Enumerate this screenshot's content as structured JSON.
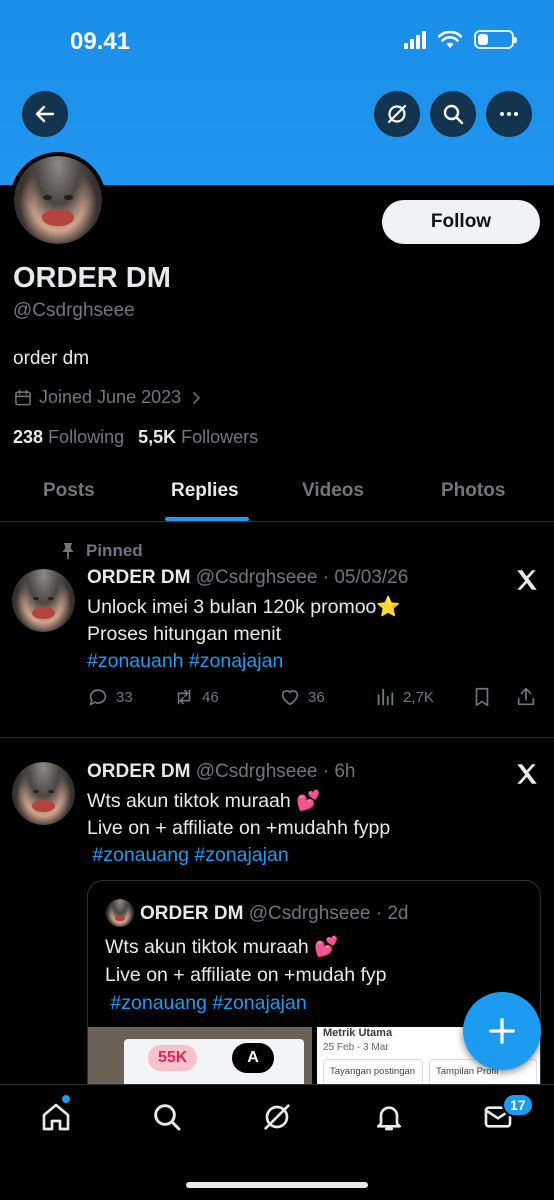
{
  "status_bar": {
    "time": "09.41"
  },
  "profile": {
    "display_name": "ORDER DM",
    "handle": "@Csdrghseee",
    "bio": "order dm",
    "joined": "Joined June 2023",
    "following_count": "238",
    "following_label": "Following",
    "followers_count": "5,5K",
    "followers_label": "Followers",
    "follow_button": "Follow"
  },
  "tabs": [
    "Posts",
    "Replies",
    "Videos",
    "Photos"
  ],
  "active_tab": "Replies",
  "posts": [
    {
      "pinned_label": "Pinned",
      "name": "ORDER DM",
      "meta": "@Csdrghseee · 05/03/26",
      "line1": "Unlock imei 3 bulan 120k promoo⭐",
      "line2": "Proses hitungan menit",
      "hashtags": "#zonauanh #zonajajan",
      "replies": "33",
      "reposts": "46",
      "likes": "36",
      "views": "2,7K"
    },
    {
      "name": "ORDER DM",
      "meta": "@Csdrghseee · 6h",
      "line1": "Wts akun tiktok muraah 💕",
      "line2": "Live on + affiliate on +mudahh fypp",
      "hashtags": " #zonauang #zonajajan",
      "quote": {
        "name": "ORDER DM",
        "meta": "@Csdrghseee · 2d",
        "line1": "Wts akun tiktok muraah 💕",
        "line2": "Live on + affiliate on +mudah fyp",
        "hashtags": " #zonauang #zonajajan",
        "media_badge": "55K",
        "media_button": "A",
        "metrik_title": "Metrik Utama",
        "metrik_date": "25 Feb - 3 Mar",
        "metrik_box1": "Tayangan postingan",
        "metrik_box2": "Tampilan Profil"
      }
    }
  ],
  "bottom_nav": {
    "messages_badge": "17"
  },
  "colors": {
    "accent": "#1d9bf0",
    "banner": "#1d92ea",
    "background": "#000000",
    "muted": "#71767b"
  }
}
